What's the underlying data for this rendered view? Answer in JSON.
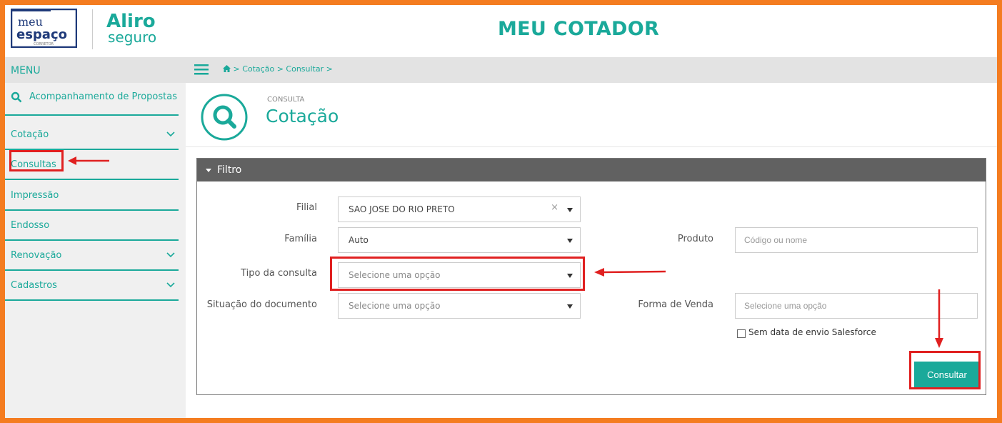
{
  "header": {
    "app_title": "MEU COTADOR",
    "logo_meu_line1": "meu",
    "logo_meu_line2": "espaço",
    "logo_meu_line3": "CORRETOR",
    "logo_aliro_line1": "Aliro",
    "logo_aliro_line2": "seguro"
  },
  "sidebar": {
    "title": "MENU",
    "items": [
      {
        "label": "Acompanhamento de Propostas",
        "icon": "search-icon"
      },
      {
        "label": "Cotação",
        "icon": "chevron-down-icon"
      },
      {
        "label": "Consultas"
      },
      {
        "label": "Impressão"
      },
      {
        "label": "Endosso"
      },
      {
        "label": "Renovação",
        "icon": "chevron-down-icon"
      },
      {
        "label": "Cadastros",
        "icon": "chevron-down-icon"
      }
    ]
  },
  "breadcrumb": {
    "items": [
      "Cotação",
      "Consultar"
    ],
    "text": "> Cotação > Consultar >"
  },
  "page": {
    "kicker": "CONSULTA",
    "title": "Cotação"
  },
  "filter": {
    "title": "Filtro",
    "filial": {
      "label": "Filial",
      "value": "SAO JOSE DO RIO PRETO",
      "clear": "×"
    },
    "familia": {
      "label": "Família",
      "value": "Auto"
    },
    "produto": {
      "label": "Produto",
      "placeholder": "Código ou nome"
    },
    "tipo_consulta": {
      "label": "Tipo da consulta",
      "value": "Selecione uma opção"
    },
    "situacao": {
      "label": "Situação do documento",
      "value": "Selecione uma opção"
    },
    "forma_venda": {
      "label": "Forma de Venda",
      "placeholder": "Selecione uma opção"
    },
    "sem_data": {
      "label": "Sem data de envio Salesforce",
      "checked": false
    },
    "submit_label": "Consultar"
  },
  "colors": {
    "accent": "#1aa99a",
    "frame": "#f47c20",
    "highlight": "#e02020",
    "panel_header": "#616161"
  }
}
